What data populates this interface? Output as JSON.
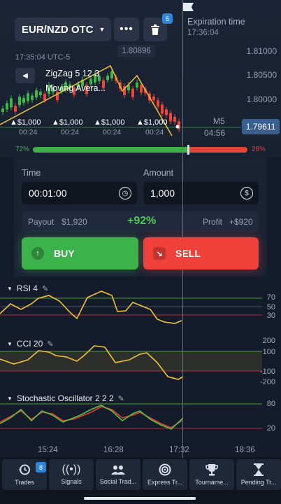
{
  "header": {
    "pair": "EUR/NZD OTC",
    "menu_icon": "more-icon",
    "trash_badge": "5",
    "expiration_label": "Expiration time",
    "expiration_time": "17:36:04",
    "server_time": "17:35:04 UTC-5"
  },
  "chart": {
    "price_ticks": [
      "1.81000",
      "1.80500",
      "1.80000"
    ],
    "top_price": "1.80896",
    "current_price": "1.79611",
    "indicators": [
      "ZigZag 5 12 3",
      "Moving Avera..."
    ],
    "timeframe": "M5",
    "countdown": "04:56",
    "trades": [
      {
        "amount": "$1,000",
        "time": "00:24"
      },
      {
        "amount": "$1,000",
        "time": "00:24"
      },
      {
        "amount": "$1,000",
        "time": "00:24"
      },
      {
        "amount": "$1,000",
        "time": "00:24"
      }
    ],
    "colors": {
      "up": "#3fb54a",
      "down": "#f0443a",
      "zigzag": "#f2c230"
    }
  },
  "sentiment": {
    "buy_label": "72%",
    "sell_label": "28%",
    "buy_percent": 72
  },
  "trade_panel": {
    "time_label": "Time",
    "time_value": "00:01:00",
    "amount_label": "Amount",
    "amount_value": "1,000",
    "payout_label": "Payout",
    "payout_value": "$1,920",
    "payout_percent": "+92%",
    "profit_label": "Profit",
    "profit_value": "+$920",
    "buy_label": "BUY",
    "sell_label": "SELL",
    "buy_color": "#3cb34a",
    "sell_color": "#f0403a"
  },
  "oscillators": [
    {
      "name": "RSI 4",
      "levels": [
        "70",
        "50",
        "30"
      ]
    },
    {
      "name": "CCI 20",
      "levels": [
        "200",
        "100",
        "-100",
        "-200"
      ]
    },
    {
      "name": "Stochastic Oscillator 2 2 2",
      "levels": [
        "80",
        "20"
      ]
    }
  ],
  "time_axis": [
    "15:24",
    "16:28",
    "17:32",
    "18:36"
  ],
  "nav": {
    "badge": "8",
    "items": [
      {
        "label": "Trades",
        "icon": "history-icon"
      },
      {
        "label": "Signals",
        "icon": "signal-icon"
      },
      {
        "label": "Social Trad...",
        "icon": "users-icon"
      },
      {
        "label": "Express Tr...",
        "icon": "target-icon"
      },
      {
        "label": "Tourname...",
        "icon": "trophy-icon"
      },
      {
        "label": "Pending Tr...",
        "icon": "hourglass-icon"
      }
    ]
  }
}
